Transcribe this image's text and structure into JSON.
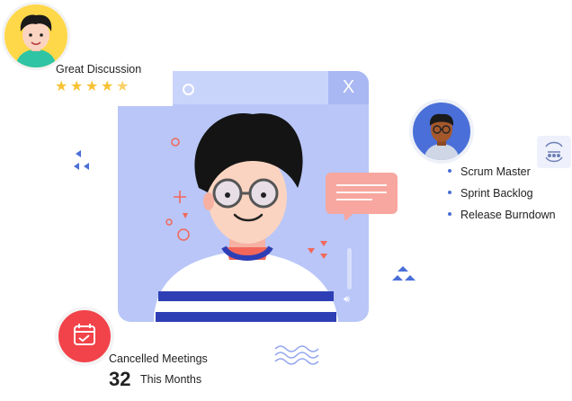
{
  "rating": {
    "label": "Great Discussion",
    "stars": 4.5,
    "star_color": "#f7c234"
  },
  "window": {
    "close_label": "X",
    "bg_color": "#b9c6f7"
  },
  "topics": [
    "Scrum Master",
    "Sprint Backlog",
    "Release Burndown"
  ],
  "meetings": {
    "label": "Cancelled Meetings",
    "count": "32",
    "unit": "This Months"
  },
  "icons": {
    "calendar": "calendar-check-icon",
    "close": "close-icon",
    "chat": "chat-bubble-icon",
    "volume": "speaker-icon",
    "scrum": "scrum-cycle-icon"
  },
  "colors": {
    "accent": "#4a6fd8",
    "danger": "#f2434a",
    "bubble": "#f7a79f"
  }
}
